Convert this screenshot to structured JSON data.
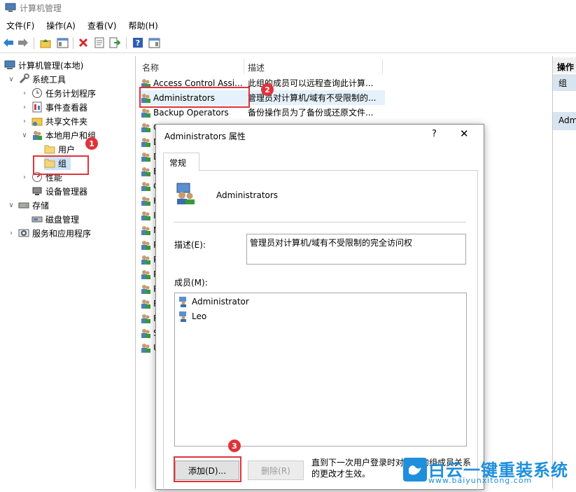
{
  "window": {
    "title": "计算机管理"
  },
  "menu": [
    "文件(F)",
    "操作(A)",
    "查看(V)",
    "帮助(H)"
  ],
  "toolbar_icons": [
    "back-arrow-icon",
    "forward-arrow-icon",
    "up-folder-icon",
    "show-hide-tree-icon",
    "delete-icon",
    "properties-icon",
    "export-icon",
    "help-icon",
    "show-hide-action-pane-icon"
  ],
  "tree": {
    "root": "计算机管理(本地)",
    "system_tools": "系统工具",
    "task_scheduler": "任务计划程序",
    "event_viewer": "事件查看器",
    "shared_folders": "共享文件夹",
    "local_users_groups": "本地用户和组",
    "users": "用户",
    "groups": "组",
    "performance": "性能",
    "device_manager": "设备管理器",
    "storage": "存储",
    "disk_management": "磁盘管理",
    "services_apps": "服务和应用程序"
  },
  "list": {
    "col_name": "名称",
    "col_desc": "描述",
    "rows": [
      {
        "name": "Access Control Assi...",
        "desc": "此组的成员可以远程查询此计算..."
      },
      {
        "name": "Administrators",
        "desc": "管理员对计算机/域有不受限制的..."
      },
      {
        "name": "Backup Operators",
        "desc": "备份操作员为了备份或还原文件..."
      }
    ],
    "hidden_initials": [
      "C",
      "D",
      "D",
      "E",
      "G",
      "H",
      "I",
      "N",
      "P",
      "P",
      "P",
      "R",
      "R",
      "R",
      "S",
      "U"
    ]
  },
  "actions": {
    "header": "操作",
    "item1": "组",
    "item2": "Adm"
  },
  "annotations": [
    "1",
    "2",
    "3"
  ],
  "dialog": {
    "title": "Administrators 属性",
    "help": "?",
    "close": "✕",
    "tab": "常规",
    "group_name": "Administrators",
    "desc_label": "描述(E):",
    "desc_value": "管理员对计算机/域有不受限制的完全访问权",
    "members_label": "成员(M):",
    "members": [
      "Administrator",
      "Leo"
    ],
    "add_button": "添加(D)...",
    "remove_button": "删除(R)",
    "note": "直到下一次用户登录时对用户的组成员关系的更改才生效。"
  },
  "watermark": {
    "text": "白云一键重装系统",
    "url": "www.baiyunxitong.com"
  }
}
